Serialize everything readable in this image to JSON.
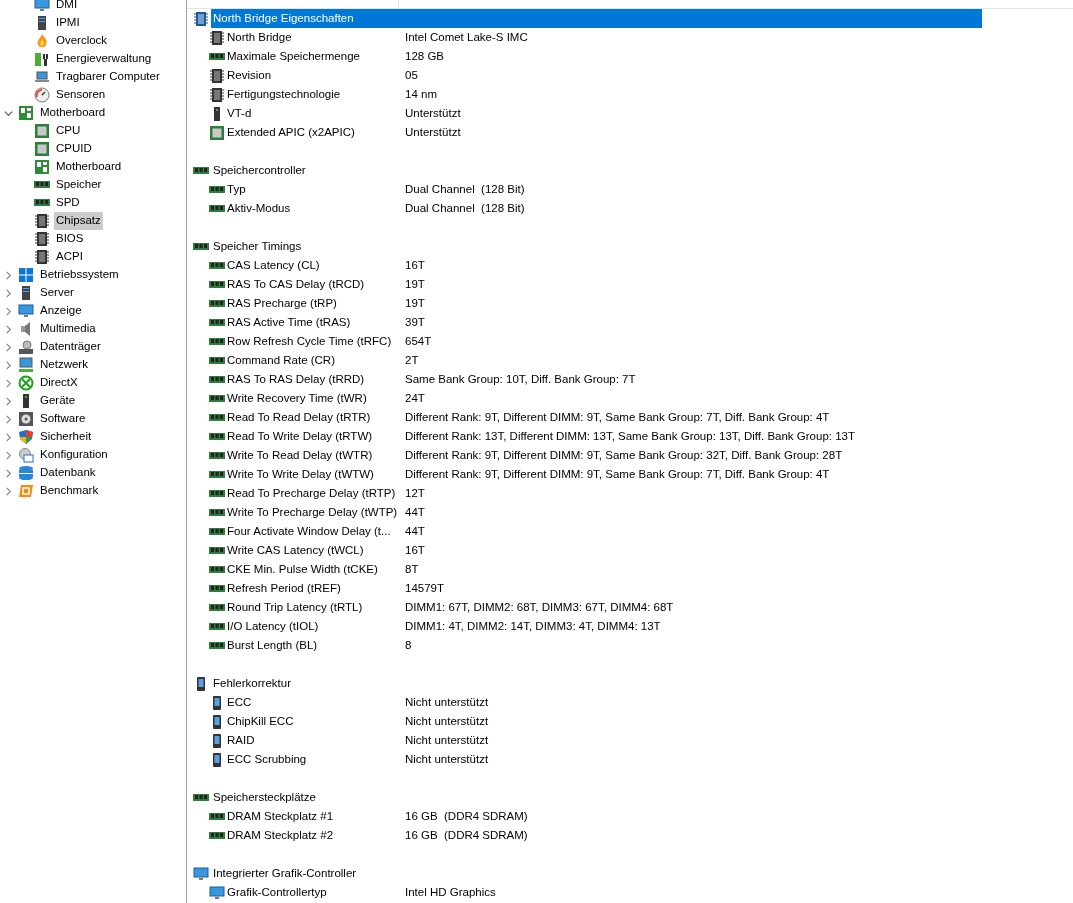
{
  "sidebar": {
    "tree": [
      {
        "children": [
          {
            "label": "DMI",
            "kind": "monitor",
            "selected": false
          },
          {
            "label": "IPMI",
            "kind": "server",
            "selected": false
          },
          {
            "label": "Overclock",
            "kind": "flame",
            "selected": false
          },
          {
            "label": "Energieverwaltung",
            "kind": "battery",
            "selected": false
          },
          {
            "label": "Tragbarer Computer",
            "kind": "laptop",
            "selected": false
          },
          {
            "label": "Sensoren",
            "kind": "gauge",
            "selected": false
          }
        ]
      },
      {
        "label": "Motherboard",
        "kind": "board",
        "selected": false,
        "expanded": true,
        "children": [
          {
            "label": "CPU",
            "kind": "cpu",
            "selected": false
          },
          {
            "label": "CPUID",
            "kind": "cpu",
            "selected": false
          },
          {
            "label": "Motherboard",
            "kind": "board",
            "selected": false
          },
          {
            "label": "Speicher",
            "kind": "ram",
            "selected": false
          },
          {
            "label": "SPD",
            "kind": "ram",
            "selected": false
          },
          {
            "label": "Chipsatz",
            "kind": "chip",
            "selected": true
          },
          {
            "label": "BIOS",
            "kind": "chip",
            "selected": false
          },
          {
            "label": "ACPI",
            "kind": "chip",
            "selected": false
          }
        ]
      },
      {
        "label": "Betriebssystem",
        "kind": "windows",
        "selected": false,
        "expanded": false
      },
      {
        "label": "Server",
        "kind": "server",
        "selected": false,
        "expanded": false
      },
      {
        "label": "Anzeige",
        "kind": "monitor",
        "selected": false,
        "expanded": false
      },
      {
        "label": "Multimedia",
        "kind": "speaker",
        "selected": false,
        "expanded": false
      },
      {
        "label": "Datenträger",
        "kind": "disk",
        "selected": false,
        "expanded": false
      },
      {
        "label": "Netzwerk",
        "kind": "network",
        "selected": false,
        "expanded": false
      },
      {
        "label": "DirectX",
        "kind": "xbox",
        "selected": false,
        "expanded": false
      },
      {
        "label": "Geräte",
        "kind": "device",
        "selected": false,
        "expanded": false
      },
      {
        "label": "Software",
        "kind": "software",
        "selected": false,
        "expanded": false
      },
      {
        "label": "Sicherheit",
        "kind": "shield",
        "selected": false,
        "expanded": false
      },
      {
        "label": "Konfiguration",
        "kind": "config",
        "selected": false,
        "expanded": false
      },
      {
        "label": "Datenbank",
        "kind": "database",
        "selected": false,
        "expanded": false
      },
      {
        "label": "Benchmark",
        "kind": "benchmark",
        "selected": false,
        "expanded": false
      }
    ]
  },
  "details": {
    "sections": [
      {
        "title": "North Bridge Eigenschaften",
        "kind": "nb",
        "selected": true,
        "rows": [
          {
            "label": "North Bridge",
            "value": "Intel Comet Lake-S IMC",
            "kind": "chip"
          },
          {
            "label": "Maximale Speichermenge",
            "value": "128 GB",
            "kind": "ram"
          },
          {
            "label": "Revision",
            "value": "05",
            "kind": "chip"
          },
          {
            "label": "Fertigungstechnologie",
            "value": "14 nm",
            "kind": "chip"
          },
          {
            "label": "VT-d",
            "value": "Unterstützt",
            "kind": "device"
          },
          {
            "label": "Extended APIC (x2APIC)",
            "value": "Unterstützt",
            "kind": "cpu"
          }
        ]
      },
      {
        "title": "Speichercontroller",
        "kind": "ram",
        "selected": false,
        "rows": [
          {
            "label": "Typ",
            "value": "Dual Channel  (128 Bit)",
            "kind": "ram"
          },
          {
            "label": "Aktiv-Modus",
            "value": "Dual Channel  (128 Bit)",
            "kind": "ram"
          }
        ]
      },
      {
        "title": "Speicher Timings",
        "kind": "ram",
        "selected": false,
        "rows": [
          {
            "label": "CAS Latency (CL)",
            "value": "16T",
            "kind": "ram"
          },
          {
            "label": "RAS To CAS Delay (tRCD)",
            "value": "19T",
            "kind": "ram"
          },
          {
            "label": "RAS Precharge (tRP)",
            "value": "19T",
            "kind": "ram"
          },
          {
            "label": "RAS Active Time (tRAS)",
            "value": "39T",
            "kind": "ram"
          },
          {
            "label": "Row Refresh Cycle Time (tRFC)",
            "value": "654T",
            "kind": "ram"
          },
          {
            "label": "Command Rate (CR)",
            "value": "2T",
            "kind": "ram"
          },
          {
            "label": "RAS To RAS Delay (tRRD)",
            "value": "Same Bank Group: 10T, Diff. Bank Group: 7T",
            "kind": "ram"
          },
          {
            "label": "Write Recovery Time (tWR)",
            "value": "24T",
            "kind": "ram"
          },
          {
            "label": "Read To Read Delay (tRTR)",
            "value": "Different Rank: 9T, Different DIMM: 9T, Same Bank Group: 7T, Diff. Bank Group: 4T",
            "kind": "ram"
          },
          {
            "label": "Read To Write Delay (tRTW)",
            "value": "Different Rank: 13T, Different DIMM: 13T, Same Bank Group: 13T, Diff. Bank Group: 13T",
            "kind": "ram"
          },
          {
            "label": "Write To Read Delay (tWTR)",
            "value": "Different Rank: 9T, Different DIMM: 9T, Same Bank Group: 32T, Diff. Bank Group: 28T",
            "kind": "ram"
          },
          {
            "label": "Write To Write Delay (tWTW)",
            "value": "Different Rank: 9T, Different DIMM: 9T, Same Bank Group: 7T, Diff. Bank Group: 4T",
            "kind": "ram"
          },
          {
            "label": "Read To Precharge Delay (tRTP)",
            "value": "12T",
            "kind": "ram"
          },
          {
            "label": "Write To Precharge Delay (tWTP)",
            "value": "44T",
            "kind": "ram"
          },
          {
            "label": "Four Activate Window Delay (t...",
            "value": "44T",
            "kind": "ram"
          },
          {
            "label": "Write CAS Latency (tWCL)",
            "value": "16T",
            "kind": "ram"
          },
          {
            "label": "CKE Min. Pulse Width (tCKE)",
            "value": "8T",
            "kind": "ram"
          },
          {
            "label": "Refresh Period (tREF)",
            "value": "14579T",
            "kind": "ram"
          },
          {
            "label": "Round Trip Latency (tRTL)",
            "value": "DIMM1: 67T, DIMM2: 68T, DIMM3: 67T, DIMM4: 68T",
            "kind": "ram"
          },
          {
            "label": "I/O Latency (tIOL)",
            "value": "DIMM1: 4T, DIMM2: 14T, DIMM3: 4T, DIMM4: 13T",
            "kind": "ram"
          },
          {
            "label": "Burst Length (BL)",
            "value": "8",
            "kind": "ram"
          }
        ]
      },
      {
        "title": "Fehlerkorrektur",
        "kind": "phone",
        "selected": false,
        "rows": [
          {
            "label": "ECC",
            "value": "Nicht unterstützt",
            "kind": "phone"
          },
          {
            "label": "ChipKill ECC",
            "value": "Nicht unterstützt",
            "kind": "phone"
          },
          {
            "label": "RAID",
            "value": "Nicht unterstützt",
            "kind": "phone"
          },
          {
            "label": "ECC Scrubbing",
            "value": "Nicht unterstützt",
            "kind": "phone"
          }
        ]
      },
      {
        "title": "Speichersteckplätze",
        "kind": "ram",
        "selected": false,
        "rows": [
          {
            "label": "DRAM Steckplatz #1",
            "value": "16 GB  (DDR4 SDRAM)",
            "kind": "ram"
          },
          {
            "label": "DRAM Steckplatz #2",
            "value": "16 GB  (DDR4 SDRAM)",
            "kind": "ram"
          }
        ]
      },
      {
        "title": "Integrierter Grafik-Controller",
        "kind": "monitor",
        "selected": false,
        "rows": [
          {
            "label": "Grafik-Controllertyp",
            "value": "Intel HD Graphics",
            "kind": "monitor"
          }
        ]
      }
    ]
  }
}
